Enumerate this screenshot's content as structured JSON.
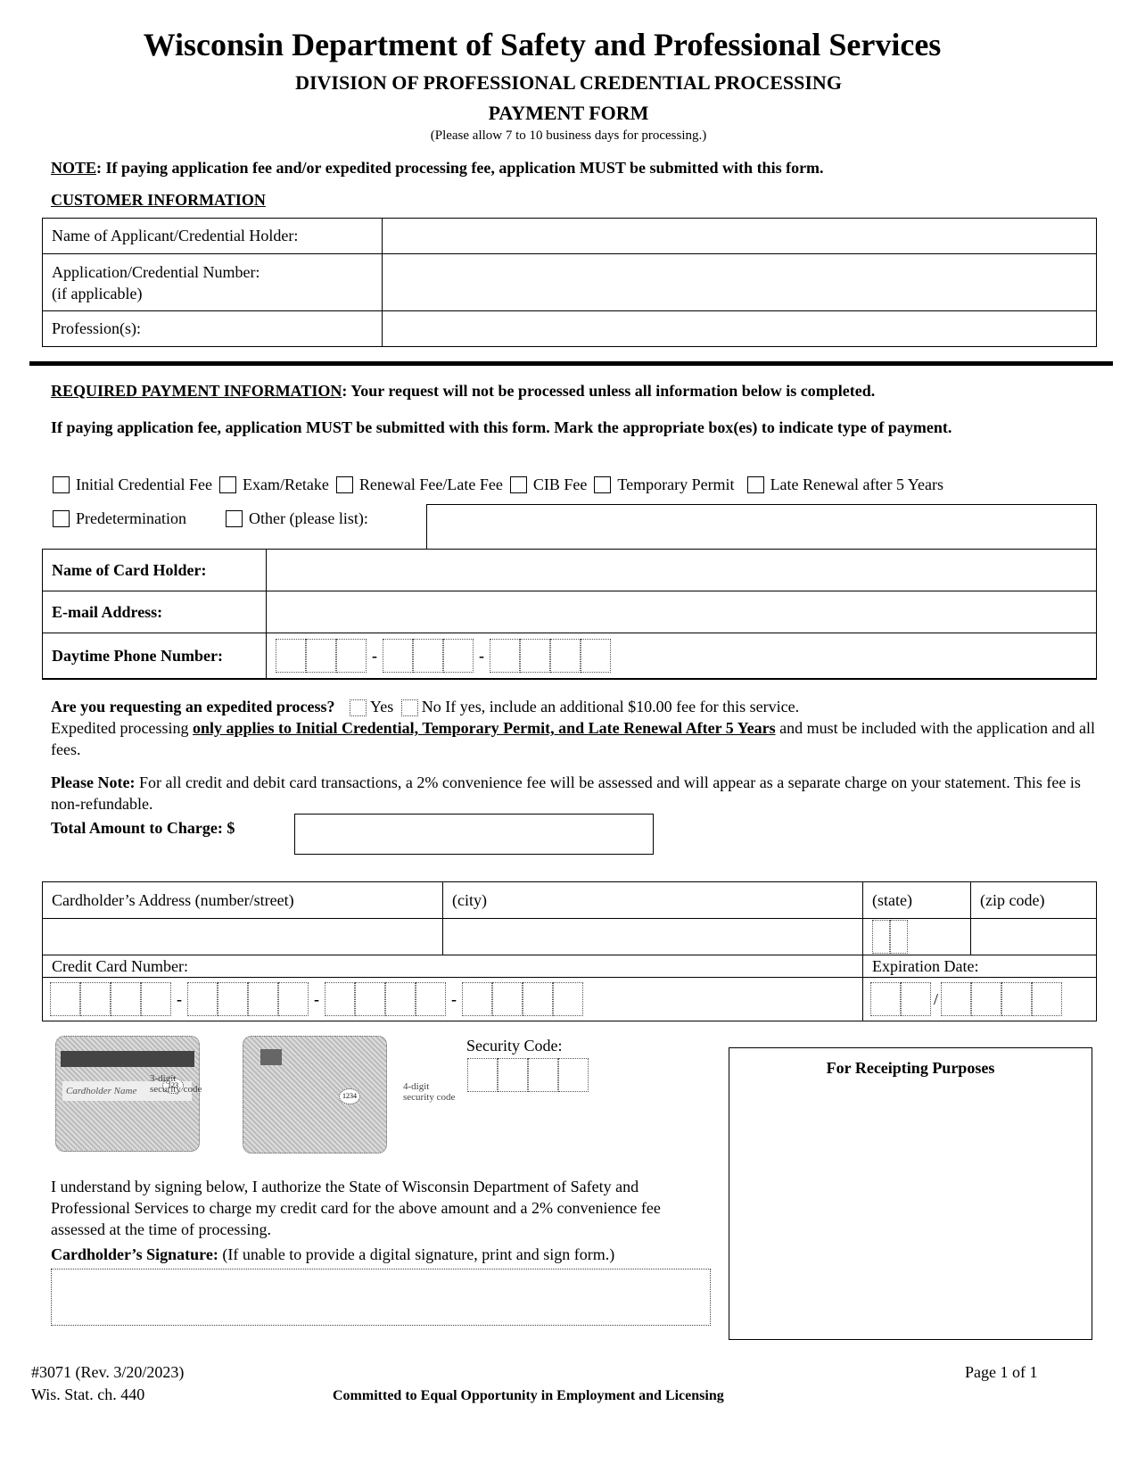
{
  "header": {
    "title": "Wisconsin Department of Safety and Professional Services",
    "division": "DIVISION OF PROFESSIONAL CREDENTIAL PROCESSING",
    "form_name": "PAYMENT FORM",
    "processing_note": "(Please allow 7 to 10 business days for processing.)"
  },
  "note": {
    "label": "NOTE",
    "text": ": If paying application fee and/or expedited processing fee, application MUST be submitted with this form."
  },
  "customer_info": {
    "heading": "CUSTOMER INFORMATION",
    "rows": [
      {
        "label": "Name of Applicant/Credential Holder:",
        "value": ""
      },
      {
        "label": "Application/Credential Number:",
        "sublabel": "(if applicable)",
        "value": ""
      },
      {
        "label": "Profession(s):",
        "value": ""
      }
    ]
  },
  "required_payment": {
    "heading": "REQUIRED PAYMENT INFORMATION",
    "heading_text": ": Your request will not be processed unless all information below is completed.",
    "instruction": "If paying application fee, application MUST be submitted with this form.  Mark the appropriate box(es) to indicate type of payment.",
    "payment_types": [
      {
        "label": "Initial Credential Fee",
        "checked": false
      },
      {
        "label": "Exam/Retake",
        "checked": false
      },
      {
        "label": "Renewal Fee/Late Fee",
        "checked": false
      },
      {
        "label": "CIB Fee",
        "checked": false
      },
      {
        "label": "Temporary Permit",
        "checked": false
      },
      {
        "label": "Late Renewal after 5 Years",
        "checked": false
      },
      {
        "label": "Predetermination",
        "checked": false
      },
      {
        "label": "Other (please list):",
        "checked": false
      }
    ],
    "other_value": ""
  },
  "card_holder": {
    "name_label": "Name of Card Holder:",
    "name_value": "",
    "email_label": "E-mail Address:",
    "email_value": "",
    "phone_label": "Daytime Phone Number:",
    "phone_value": "",
    "phone_separator": "-"
  },
  "expedited": {
    "question": "Are you requesting an expedited process?",
    "yes_label": "Yes",
    "no_label": "No",
    "fee_text": "If yes, include an additional $10.00 fee for this service.",
    "line2_prefix": "Expedited processing ",
    "line2_emph": "only applies to Initial Credential, Temporary Permit, and Late Renewal After 5 Years",
    "line2_suffix": " and must be included with the application and all fees."
  },
  "please_note": {
    "label": "Please Note:",
    "text": " For all credit and debit card transactions, a 2% convenience fee will be assessed and will appear as a separate charge on your statement. This fee is non-refundable."
  },
  "total": {
    "label": "Total Amount to Charge: $",
    "value": ""
  },
  "address": {
    "street_label": "Cardholder’s Address (number/street)",
    "city_label": "(city)",
    "state_label": "(state)",
    "zip_label": "(zip code)",
    "card_number_label": "Credit Card Number:",
    "expiration_label": "Expiration Date:",
    "card_separator": "-",
    "exp_separator": "/"
  },
  "security": {
    "label": "Security Code:",
    "card_back_caption": "3-digit security code",
    "card_front_caption": "4-digit security code",
    "card_back_name": "Cardholder Name",
    "card_back_code": "123",
    "card_front_code": "1234"
  },
  "receipt": {
    "title": "For Receipting Purposes"
  },
  "authorization": {
    "text": "I understand by signing below, I authorize the State of Wisconsin Department of Safety and Professional Services to charge my credit card for the above amount and a 2% convenience fee assessed at the time of processing.",
    "signature_label": "Cardholder’s Signature:",
    "signature_hint": " (If unable to provide a digital signature, print and sign form.)"
  },
  "footer": {
    "form_number": "#3071 (Rev. 3/20/2023)",
    "statute": "Wis. Stat. ch. 440",
    "tagline": "Committed to Equal Opportunity in Employment and Licensing",
    "page": "Page 1 of 1"
  }
}
